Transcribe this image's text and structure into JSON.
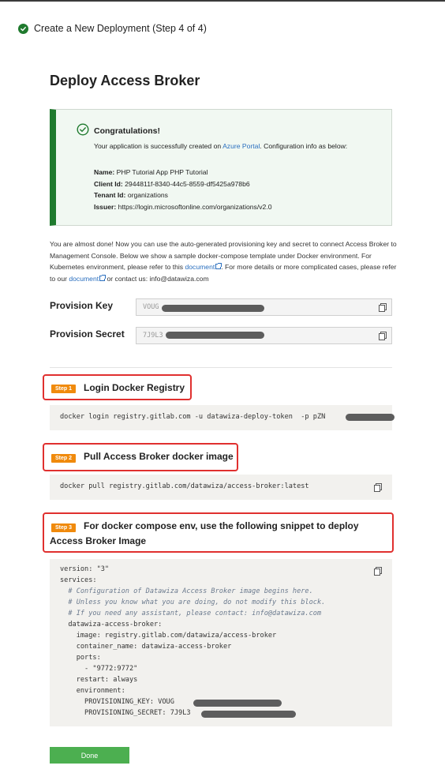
{
  "header": {
    "step_title": "Create a New Deployment (Step 4 of 4)"
  },
  "page": {
    "title": "Deploy Access Broker"
  },
  "success": {
    "title": "Congratulations!",
    "line1_pre": "Your application is successfully created on ",
    "line1_link": "Azure Portal",
    "line1_post": ". Configuration info as below:",
    "name_label": "Name:",
    "name_value": "PHP Tutorial App PHP Tutorial",
    "client_id_label": "Client Id:",
    "client_id_value": "2944811f-8340-44c5-8559-df5425a978b6",
    "tenant_id_label": "Tenant Id:",
    "tenant_id_value": "organizations",
    "issuer_label": "Issuer:",
    "issuer_value": "https://login.microsoftonline.com/organizations/v2.0"
  },
  "intro": {
    "text1": "You are almost done! Now you can use the auto-generated provisioning key and secret to connect Access Broker to Management Console. Below we show a sample docker-compose template under Docker environment. For Kubernetes environment, please refer to this ",
    "link1": "document",
    "text2": ". For more details or more complicated cases, please refer to our ",
    "link2": "document",
    "text3": " or contact us: info@datawiza.com"
  },
  "provision": {
    "key_label": "Provision Key",
    "key_value": "VOUG",
    "secret_label": "Provision Secret",
    "secret_value": "7J9L3"
  },
  "steps": [
    {
      "badge": "Step 1",
      "title": "Login Docker Registry",
      "code": [
        "docker login registry.gitlab.com -u datawiza-deploy-token  -p pZN"
      ]
    },
    {
      "badge": "Step 2",
      "title": "Pull Access Broker docker image",
      "code": [
        "docker pull registry.gitlab.com/datawiza/access-broker:latest"
      ]
    },
    {
      "badge": "Step 3",
      "title": "For docker compose env, use the following snippet to deploy Access Broker Image",
      "code": [
        "version: \"3\"",
        "services:",
        "  # Configuration of Datawiza Access Broker image begins here.",
        "  # Unless you know what you are doing, do not modify this block.",
        "  # If you need any assistant, please contact: info@datawiza.com",
        "  datawiza-access-broker:",
        "    image: registry.gitlab.com/datawiza/access-broker",
        "    container_name: datawiza-access-broker",
        "    ports:",
        "      - \"9772:9772\"",
        "    restart: always",
        "    environment:",
        "      PROVISIONING_KEY: VOUG",
        "      PROVISIONING_SECRET: 7J9L3"
      ]
    }
  ],
  "actions": {
    "done_label": "Done"
  },
  "colors": {
    "success_green": "#1f7a2e",
    "link_blue": "#2a6fbf",
    "step_badge_orange": "#f08a0c",
    "highlight_red": "#e0302f",
    "done_button": "#4caf50"
  }
}
